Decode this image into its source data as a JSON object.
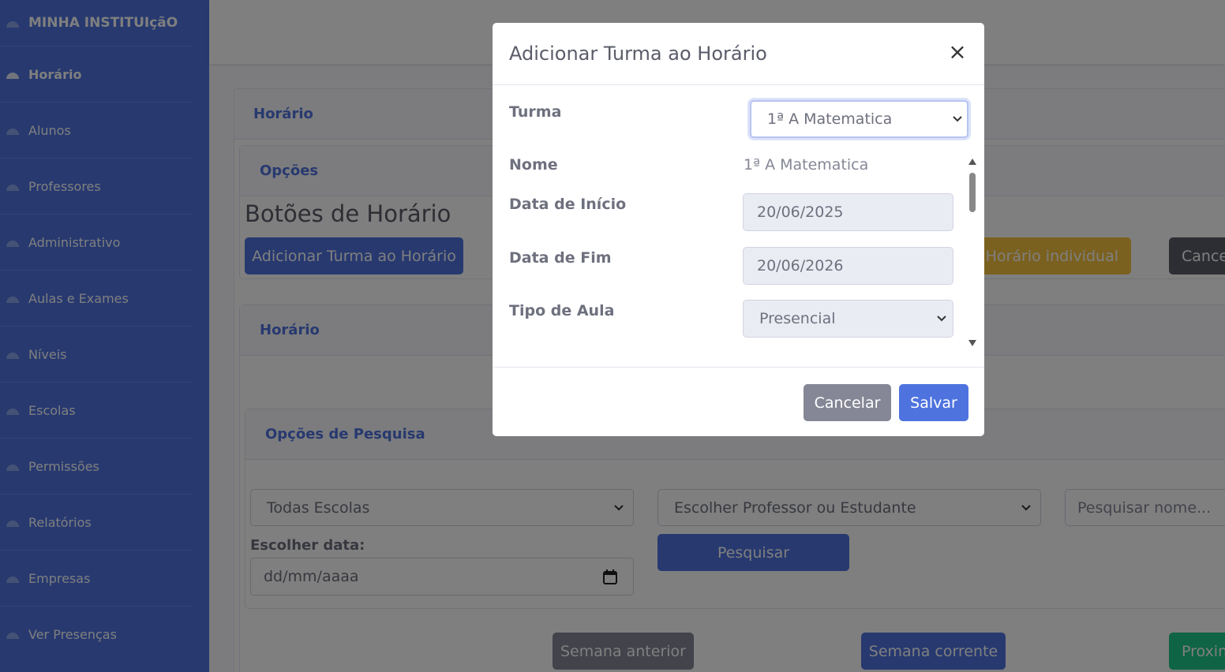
{
  "sidebar": {
    "brand": "MINHA INSTITUIçãO",
    "items": [
      {
        "label": "Horário",
        "active": true
      },
      {
        "label": "Alunos"
      },
      {
        "label": "Professores"
      },
      {
        "label": "Administrativo"
      },
      {
        "label": "Aulas e Exames"
      },
      {
        "label": "Níveis"
      },
      {
        "label": "Escolas"
      },
      {
        "label": "Permissões"
      },
      {
        "label": "Relatórios"
      },
      {
        "label": "Empresas"
      },
      {
        "label": "Ver Presenças"
      }
    ]
  },
  "main": {
    "card_title": "Horário",
    "options_title": "Opções",
    "buttons_heading": "Botões de Horário",
    "add_button": "Adicionar Turma ao Horário",
    "individual_button": "a Horário individual",
    "cancel_button_partial": "Cance",
    "schedule_title": "Horário",
    "search_options_title": "Opções de Pesquisa",
    "school_select": "Todas Escolas",
    "person_select": "Escolher Professor ou Estudante",
    "name_search_placeholder": "Pesquisar nome...",
    "date_label": "Escolher data:",
    "date_placeholder": "dd/mm/aaaa",
    "search_button": "Pesquisar",
    "prev_week": "Semana anterior",
    "current_week": "Semana corrente",
    "next_week_partial": "Proxin"
  },
  "modal": {
    "title": "Adicionar Turma ao Horário",
    "close": "×",
    "turma_label": "Turma",
    "turma_value": "1ª A Matematica",
    "nome_label": "Nome",
    "nome_value": "1ª A Matematica",
    "inicio_label": "Data de Início",
    "inicio_value": "20/06/2025",
    "fim_label": "Data de Fim",
    "fim_value": "20/06/2026",
    "tipo_label": "Tipo de Aula",
    "tipo_value": "Presencial",
    "cancel": "Cancelar",
    "save": "Salvar"
  },
  "colors": {
    "primary": "#4e73df",
    "secondary": "#858796",
    "warning": "#f6c23e",
    "success": "#1cc88a",
    "dark": "#5a5c69"
  }
}
